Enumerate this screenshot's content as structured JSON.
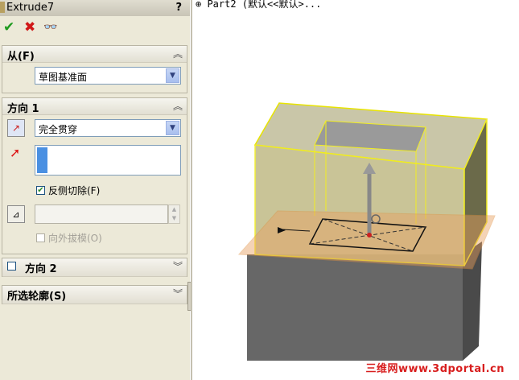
{
  "feature": {
    "title": "Extrude7",
    "help": "?"
  },
  "actions": {
    "ok": "✔",
    "cancel": "✖",
    "preview": "👓"
  },
  "from_group": {
    "title": "从(F)",
    "value": "草图基准面"
  },
  "direction1": {
    "title": "方向 1",
    "end_condition": "完全贯穿",
    "flip_side_label": "反侧切除(F)",
    "flip_side_checked": true,
    "draft_label": "向外拔模(O)",
    "draft_checked": false
  },
  "direction2": {
    "title": "方向 2",
    "checked": false
  },
  "selected_contours": {
    "title": "所选轮廓(S)"
  },
  "tree": {
    "text": "⊕ Part2 (默认<<默认>..."
  },
  "watermark": "三维网www.3dportal.cn"
}
